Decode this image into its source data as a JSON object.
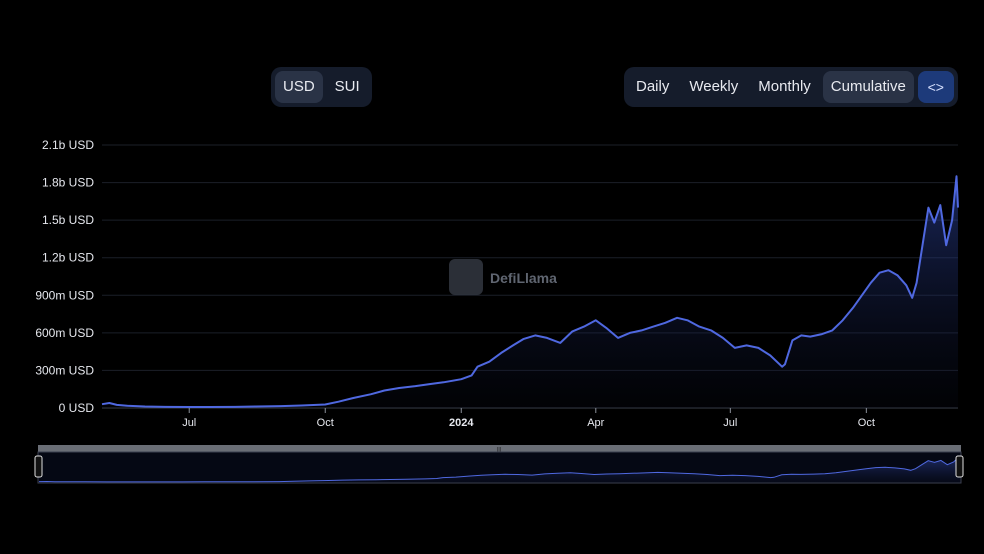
{
  "toggles": {
    "unit": [
      {
        "label": "USD",
        "active": true
      },
      {
        "label": "SUI",
        "active": false
      }
    ],
    "period": [
      {
        "label": "Daily",
        "active": false
      },
      {
        "label": "Weekly",
        "active": false
      },
      {
        "label": "Monthly",
        "active": false
      },
      {
        "label": "Cumulative",
        "active": true
      }
    ],
    "embed_icon": "code-brackets-icon",
    "embed_label": "<>"
  },
  "watermark": "DefiLlama",
  "colors": {
    "line": "#4f68e0",
    "accent": "#1d3a7a"
  },
  "chart_data": {
    "type": "area",
    "title": "",
    "xlabel": "",
    "ylabel": "",
    "y_ticks": [
      "0 USD",
      "300m USD",
      "600m USD",
      "900m USD",
      "1.2b USD",
      "1.5b USD",
      "1.8b USD",
      "2.1b USD"
    ],
    "x_ticks": [
      {
        "label": "Jul",
        "date": "2023-07-01",
        "bold": false
      },
      {
        "label": "Oct",
        "date": "2023-10-01",
        "bold": false
      },
      {
        "label": "2024",
        "date": "2024-01-01",
        "bold": true
      },
      {
        "label": "Apr",
        "date": "2024-04-01",
        "bold": false
      },
      {
        "label": "Jul",
        "date": "2024-07-01",
        "bold": false
      },
      {
        "label": "Oct",
        "date": "2024-10-01",
        "bold": false
      }
    ],
    "xlim": [
      "2023-05-03",
      "2024-12-02"
    ],
    "ylim": [
      0,
      2100000000
    ],
    "grid": true,
    "series": [
      {
        "name": "",
        "x": [
          "2023-05-03",
          "2023-05-08",
          "2023-05-13",
          "2023-05-20",
          "2023-06-01",
          "2023-06-15",
          "2023-07-01",
          "2023-07-15",
          "2023-08-01",
          "2023-08-15",
          "2023-09-01",
          "2023-09-15",
          "2023-10-01",
          "2023-10-10",
          "2023-10-20",
          "2023-11-01",
          "2023-11-10",
          "2023-11-20",
          "2023-12-01",
          "2023-12-10",
          "2023-12-20",
          "2024-01-01",
          "2024-01-08",
          "2024-01-12",
          "2024-01-20",
          "2024-01-28",
          "2024-02-05",
          "2024-02-12",
          "2024-02-20",
          "2024-02-28",
          "2024-03-08",
          "2024-03-16",
          "2024-03-24",
          "2024-04-01",
          "2024-04-08",
          "2024-04-16",
          "2024-04-24",
          "2024-05-02",
          "2024-05-10",
          "2024-05-18",
          "2024-05-26",
          "2024-06-02",
          "2024-06-10",
          "2024-06-18",
          "2024-06-26",
          "2024-07-04",
          "2024-07-12",
          "2024-07-20",
          "2024-07-28",
          "2024-08-05",
          "2024-08-07",
          "2024-08-12",
          "2024-08-18",
          "2024-08-24",
          "2024-09-01",
          "2024-09-08",
          "2024-09-15",
          "2024-09-22",
          "2024-09-28",
          "2024-10-04",
          "2024-10-10",
          "2024-10-16",
          "2024-10-22",
          "2024-10-28",
          "2024-11-01",
          "2024-11-04",
          "2024-11-08",
          "2024-11-12",
          "2024-11-16",
          "2024-11-20",
          "2024-11-24",
          "2024-11-28",
          "2024-12-01",
          "2024-12-02"
        ],
        "y": [
          30000000,
          40000000,
          25000000,
          18000000,
          12000000,
          9000000,
          8000000,
          8000000,
          9000000,
          12000000,
          15000000,
          20000000,
          28000000,
          50000000,
          80000000,
          110000000,
          140000000,
          160000000,
          175000000,
          190000000,
          205000000,
          230000000,
          260000000,
          330000000,
          370000000,
          440000000,
          500000000,
          550000000,
          580000000,
          560000000,
          520000000,
          610000000,
          650000000,
          700000000,
          640000000,
          560000000,
          600000000,
          620000000,
          650000000,
          680000000,
          720000000,
          700000000,
          650000000,
          620000000,
          560000000,
          480000000,
          500000000,
          480000000,
          420000000,
          330000000,
          350000000,
          540000000,
          580000000,
          570000000,
          590000000,
          620000000,
          700000000,
          800000000,
          900000000,
          1000000000,
          1080000000,
          1100000000,
          1060000000,
          980000000,
          880000000,
          1000000000,
          1300000000,
          1600000000,
          1480000000,
          1620000000,
          1300000000,
          1500000000,
          1850000000,
          1600000000
        ]
      }
    ]
  }
}
